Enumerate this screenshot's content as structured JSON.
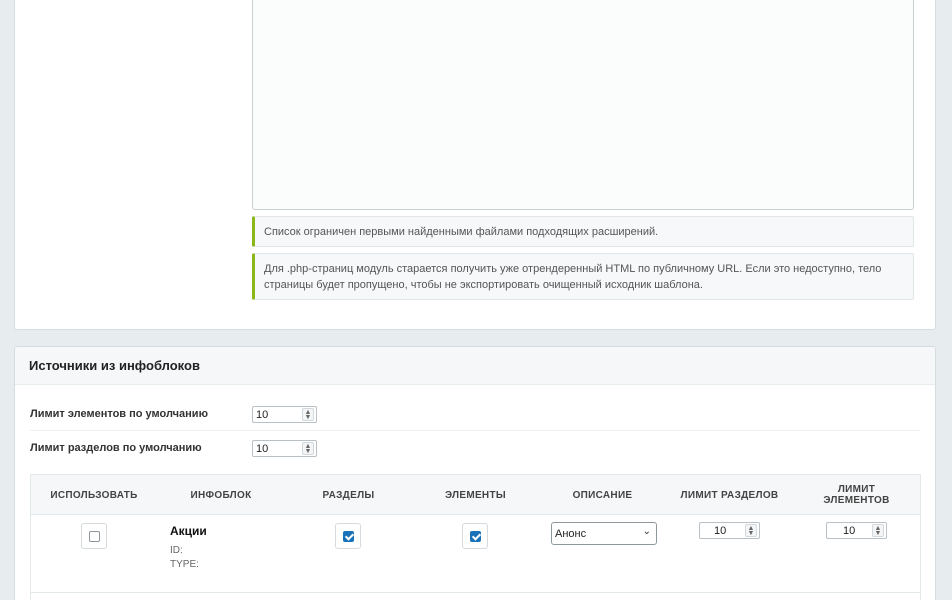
{
  "notes": {
    "limit_note": "Список ограничен первыми найденными файлами подходящих расширений.",
    "php_note": "Для .php-страниц модуль старается получить уже отрендеренный HTML по публичному URL. Если это недоступно, тело страницы будет пропущено, чтобы не экспортировать очищенный исходник шаблона."
  },
  "infoblocks": {
    "title": "Источники из инфоблоков",
    "default_elements_limit": {
      "label": "Лимит элементов по умолчанию",
      "value": "10"
    },
    "default_sections_limit": {
      "label": "Лимит разделов по умолчанию",
      "value": "10"
    },
    "table": {
      "headers": {
        "use": "ИСПОЛЬЗОВАТЬ",
        "infoblock": "ИНФОБЛОК",
        "sections": "РАЗДЕЛЫ",
        "elements": "ЭЛЕМЕНТЫ",
        "description": "ОПИСАНИЕ",
        "sections_limit": "ЛИМИТ РАЗДЕЛОВ",
        "elements_limit_line1": "ЛИМИТ",
        "elements_limit_line2": "ЭЛЕМЕНТОВ"
      },
      "rows": [
        {
          "use": false,
          "name": "Акции",
          "id_label": "ID:",
          "type_label": "TYPE:",
          "sections": true,
          "elements": true,
          "description": "Анонс",
          "sections_limit": "10",
          "elements_limit": "10"
        }
      ]
    }
  },
  "colors": {
    "accent_green": "#8cb71a",
    "check_blue": "#1a73b8",
    "page_bg": "#e7ecef"
  },
  "icons": {
    "select_chevron": "chevron-down-icon",
    "stepper": "spin-arrows-icon"
  }
}
